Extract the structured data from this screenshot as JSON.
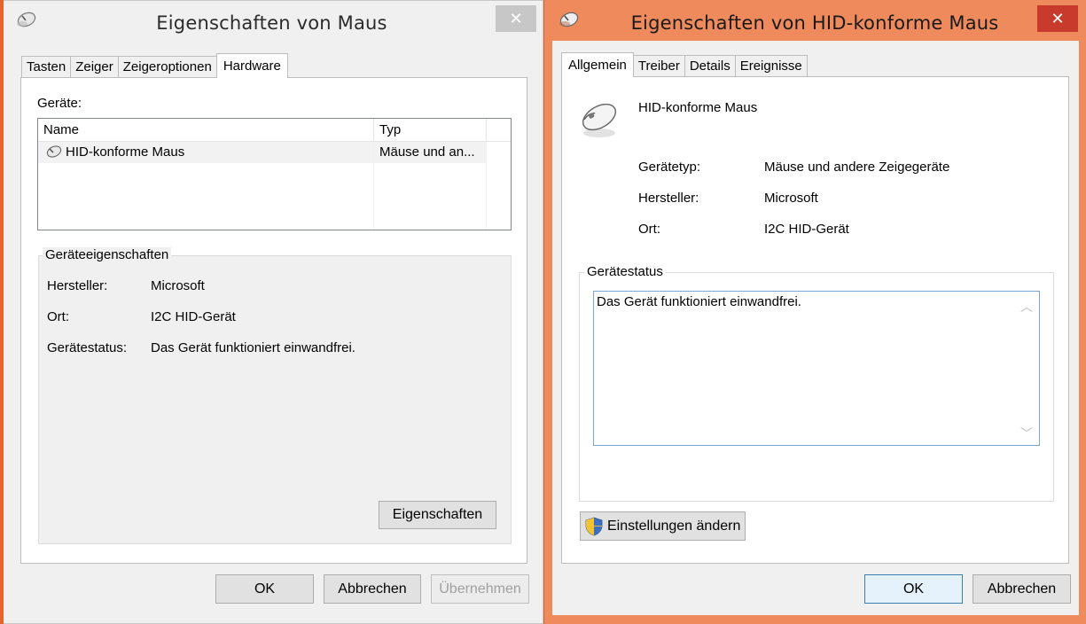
{
  "window1": {
    "title": "Eigenschaften von Maus",
    "tabs": [
      "Tasten",
      "Zeiger",
      "Zeigeroptionen",
      "Hardware"
    ],
    "active_tab": "Hardware",
    "devices_label": "Geräte:",
    "list_columns": [
      "Name",
      "Typ"
    ],
    "list_rows": [
      {
        "name": "HID-konforme Maus",
        "type": "Mäuse und an..."
      }
    ],
    "group_title": "Geräteeigenschaften",
    "properties": [
      {
        "label": "Hersteller:",
        "value": "Microsoft"
      },
      {
        "label": "Ort:",
        "value": "I2C HID-Gerät"
      },
      {
        "label": "Gerätestatus:",
        "value": "Das Gerät funktioniert einwandfrei."
      }
    ],
    "properties_button": "Eigenschaften",
    "ok_button": "OK",
    "cancel_button": "Abbrechen",
    "apply_button": "Übernehmen"
  },
  "window2": {
    "title": "Eigenschaften von HID-konforme Maus",
    "tabs": [
      "Allgemein",
      "Treiber",
      "Details",
      "Ereignisse"
    ],
    "active_tab": "Allgemein",
    "device_name": "HID-konforme Maus",
    "info": [
      {
        "label": "Gerätetyp:",
        "value": "Mäuse und andere Zeigegeräte"
      },
      {
        "label": "Hersteller:",
        "value": "Microsoft"
      },
      {
        "label": "Ort:",
        "value": "I2C HID-Gerät"
      }
    ],
    "status_group_title": "Gerätestatus",
    "status_text": "Das Gerät funktioniert einwandfrei.",
    "change_settings_button": "Einstellungen ändern",
    "ok_button": "OK",
    "cancel_button": "Abbrechen"
  },
  "colors": {
    "active_frame": "#ee8a5c",
    "close_active": "#c73a2c",
    "close_inactive": "#c7c7c7"
  }
}
